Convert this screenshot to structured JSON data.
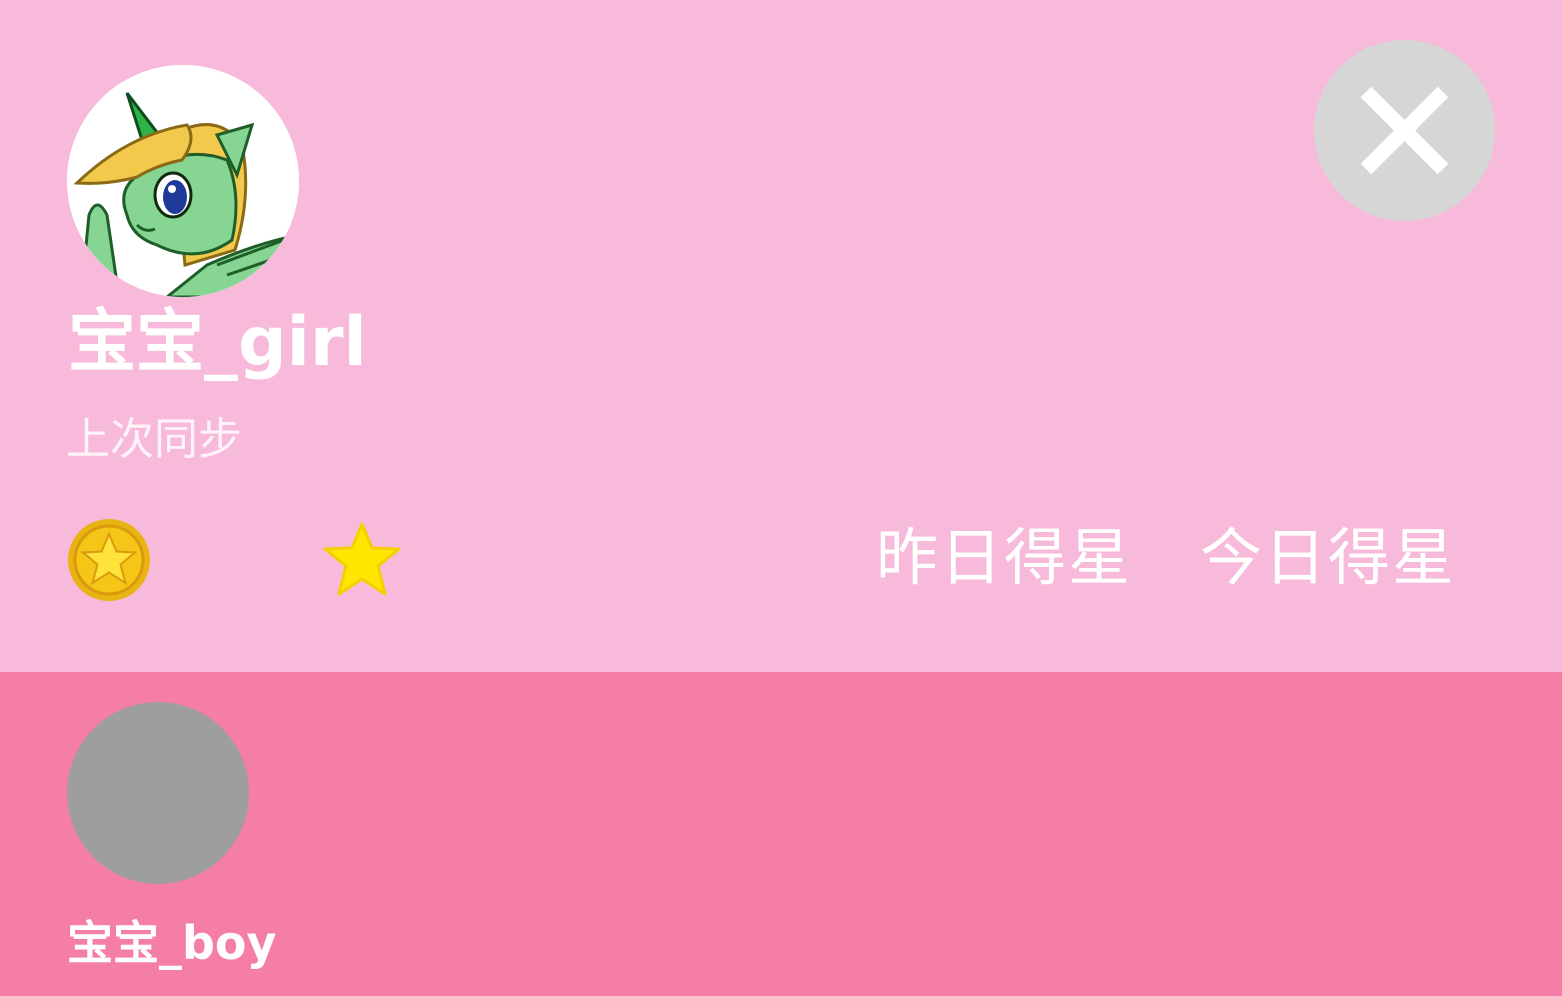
{
  "current_user": {
    "name": "宝宝_girl",
    "avatar": "unicorn-avatar",
    "sync_label": "上次同步",
    "sync_value": "",
    "coins": "",
    "stars": "",
    "yesterday_stars_label": "昨日得星",
    "today_stars_label": "今日得星"
  },
  "other_user": {
    "name": "宝宝_boy",
    "avatar": "default-avatar"
  },
  "icons": {
    "close": "close-icon",
    "coin": "coin-icon",
    "star": "star-icon"
  },
  "colors": {
    "top_panel": "#f7badb",
    "bottom_panel": "#f47ea8",
    "close_button": "#d6d6d6",
    "placeholder_avatar": "#9e9e9e",
    "coin_gold": "#f2c811",
    "star_yellow": "#ffe600"
  }
}
